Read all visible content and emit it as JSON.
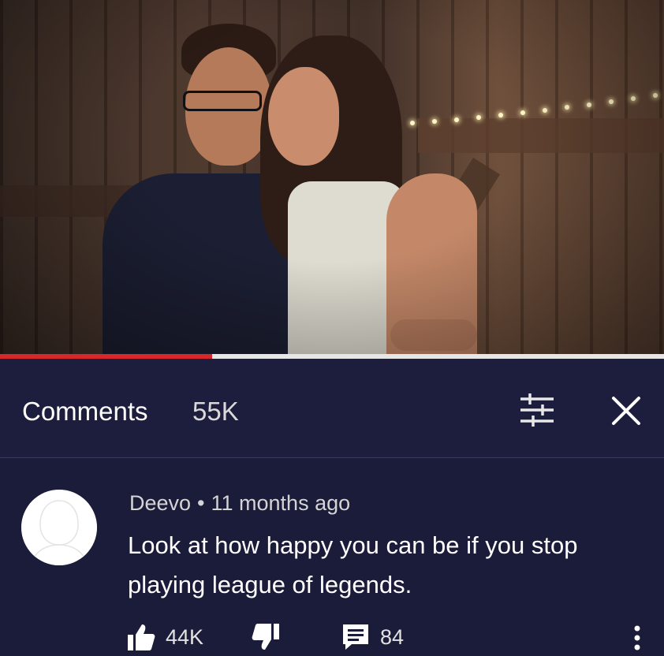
{
  "video": {
    "progress": 0.32,
    "accent": "#d6282b"
  },
  "comments_header": {
    "title": "Comments",
    "count": "55K",
    "sort_icon": "sort-filter-icon",
    "close_icon": "close-icon"
  },
  "comment": {
    "author": "Deevo",
    "separator": "•",
    "time": "11 months ago",
    "text": "Look at how happy you can be if you stop playing league of legends.",
    "likes": "44K",
    "replies": "84",
    "avatar_icon": "default-avatar-icon",
    "like_icon": "thumbs-up-icon",
    "dislike_icon": "thumbs-down-icon",
    "reply_icon": "reply-icon",
    "more_icon": "more-options-icon"
  },
  "colors": {
    "panel_bg": "#1b1b3a",
    "text": "#ffffff",
    "progress_played": "#d6282b",
    "progress_buffered": "#e6e6e6"
  }
}
